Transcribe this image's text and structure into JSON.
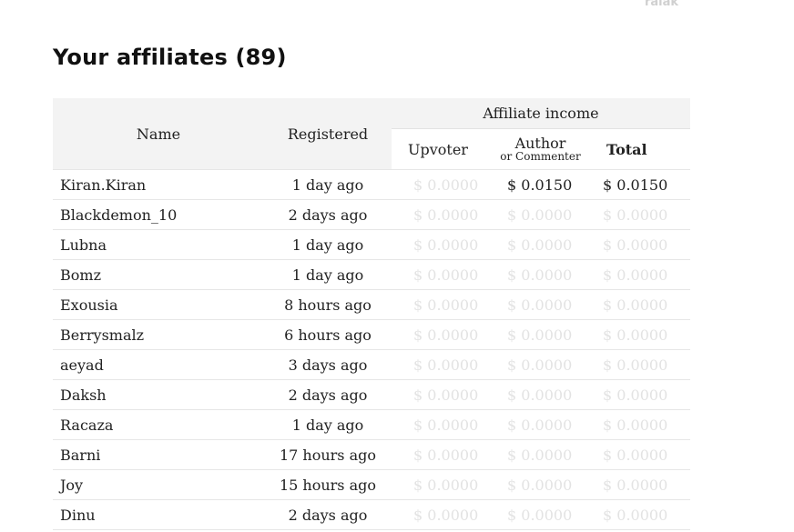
{
  "top_faded_text": "ralak",
  "page_title": "Your affiliates (89)",
  "table": {
    "headers": {
      "name": "Name",
      "registered": "Registered",
      "affiliate_income": "Affiliate income",
      "upvoter": "Upvoter",
      "author": "Author",
      "author_sub": "or Commenter",
      "total": "Total"
    },
    "rows": [
      {
        "name": "Kiran.Kiran",
        "registered": "1 day ago",
        "upvoter": "$ 0.0000",
        "author": "$ 0.0150",
        "total": "$ 0.0150"
      },
      {
        "name": "Blackdemon_10",
        "registered": "2 days ago",
        "upvoter": "$ 0.0000",
        "author": "$ 0.0000",
        "total": "$ 0.0000"
      },
      {
        "name": "Lubna",
        "registered": "1 day ago",
        "upvoter": "$ 0.0000",
        "author": "$ 0.0000",
        "total": "$ 0.0000"
      },
      {
        "name": "Bomz",
        "registered": "1 day ago",
        "upvoter": "$ 0.0000",
        "author": "$ 0.0000",
        "total": "$ 0.0000"
      },
      {
        "name": "Exousia",
        "registered": "8 hours ago",
        "upvoter": "$ 0.0000",
        "author": "$ 0.0000",
        "total": "$ 0.0000"
      },
      {
        "name": "Berrysmalz",
        "registered": "6 hours ago",
        "upvoter": "$ 0.0000",
        "author": "$ 0.0000",
        "total": "$ 0.0000"
      },
      {
        "name": "aeyad",
        "registered": "3 days ago",
        "upvoter": "$ 0.0000",
        "author": "$ 0.0000",
        "total": "$ 0.0000"
      },
      {
        "name": "Daksh",
        "registered": "2 days ago",
        "upvoter": "$ 0.0000",
        "author": "$ 0.0000",
        "total": "$ 0.0000"
      },
      {
        "name": "Racaza",
        "registered": "1 day ago",
        "upvoter": "$ 0.0000",
        "author": "$ 0.0000",
        "total": "$ 0.0000"
      },
      {
        "name": "Barni",
        "registered": "17 hours ago",
        "upvoter": "$ 0.0000",
        "author": "$ 0.0000",
        "total": "$ 0.0000"
      },
      {
        "name": "Joy",
        "registered": "15 hours ago",
        "upvoter": "$ 0.0000",
        "author": "$ 0.0000",
        "total": "$ 0.0000"
      },
      {
        "name": "Dinu",
        "registered": "2 days ago",
        "upvoter": "$ 0.0000",
        "author": "$ 0.0000",
        "total": "$ 0.0000"
      }
    ]
  },
  "colors": {
    "header_bg": "#f3f3f3",
    "zero_value": "#e3e3e3",
    "text": "#222222"
  }
}
